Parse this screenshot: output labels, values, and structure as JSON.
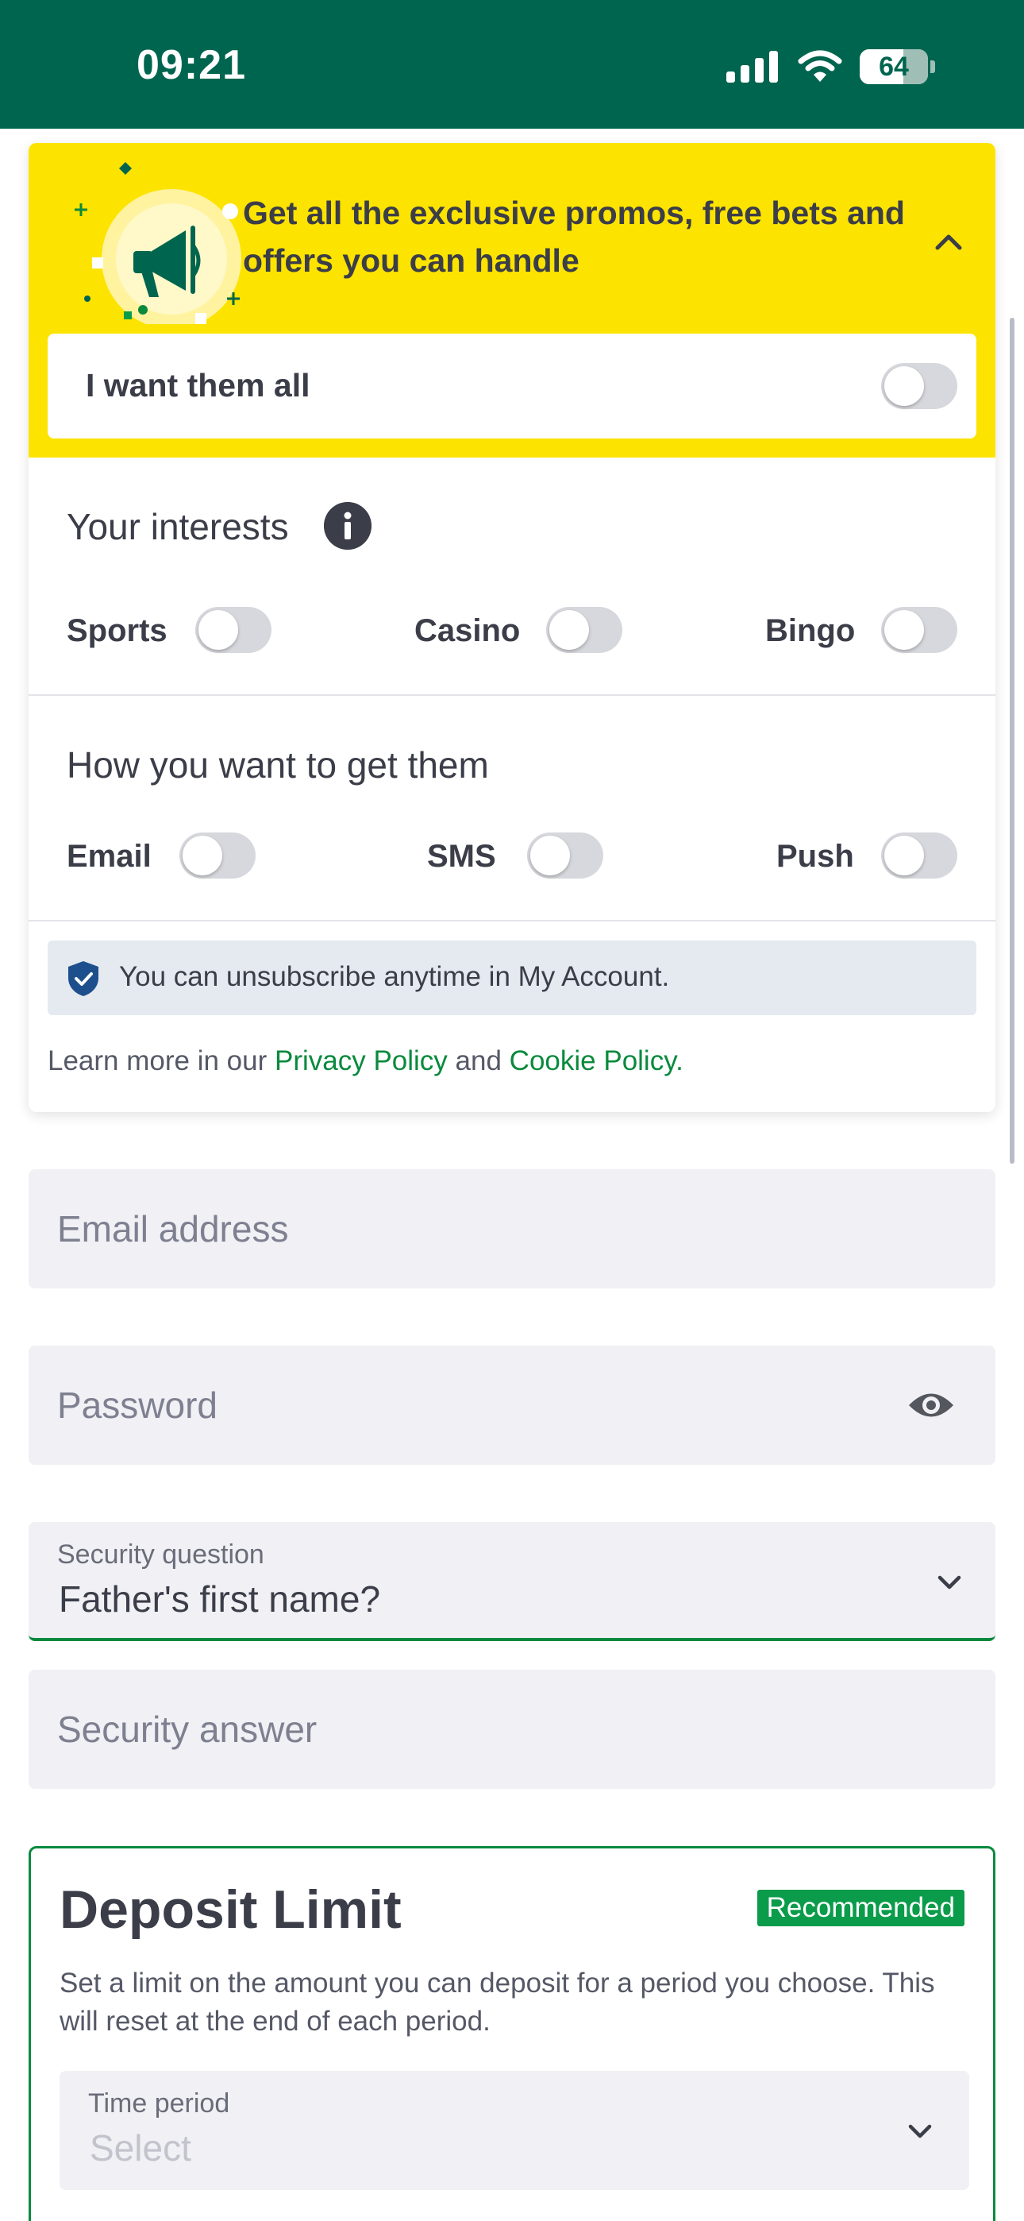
{
  "status_bar": {
    "time": "09:21",
    "battery": "64",
    "battery_level": 0.64
  },
  "marketing": {
    "title": "Get all the exclusive promos, free bets and offers you can handle",
    "want_all_label": "I want them all",
    "interests_title": "Your interests",
    "interests": [
      {
        "label": "Sports",
        "on": false
      },
      {
        "label": "Casino",
        "on": false
      },
      {
        "label": "Bingo",
        "on": false
      }
    ],
    "channels_title": "How you want to get them",
    "channels": [
      {
        "label": "Email",
        "on": false
      },
      {
        "label": "SMS",
        "on": false
      },
      {
        "label": "Push",
        "on": false
      }
    ],
    "unsubscribe_note": "You can unsubscribe anytime in My Account.",
    "learn_prefix": "Learn more in our ",
    "privacy_link": "Privacy Policy",
    "learn_and": " and ",
    "cookie_link": "Cookie Policy",
    "learn_suffix": "."
  },
  "form": {
    "email_placeholder": "Email address",
    "password_placeholder": "Password",
    "security_question_label": "Security question",
    "security_question_value": "Father's first name?",
    "security_answer_placeholder": "Security answer"
  },
  "deposit_limit": {
    "title": "Deposit Limit",
    "badge": "Recommended",
    "description": "Set a limit on the amount you can deposit for a period you choose. This will reset at the end of each period.",
    "time_period_label": "Time period",
    "time_period_value": "Select"
  },
  "colors": {
    "header": "#00654f",
    "promo": "#fce300",
    "accent": "#0a8a3d",
    "badge": "#0a9c4a"
  },
  "icons": [
    "signal-icon",
    "wifi-icon",
    "battery-icon",
    "megaphone-icon",
    "chevron-up-icon",
    "info-icon",
    "shield-check-icon",
    "eye-icon",
    "chevron-down-icon"
  ]
}
